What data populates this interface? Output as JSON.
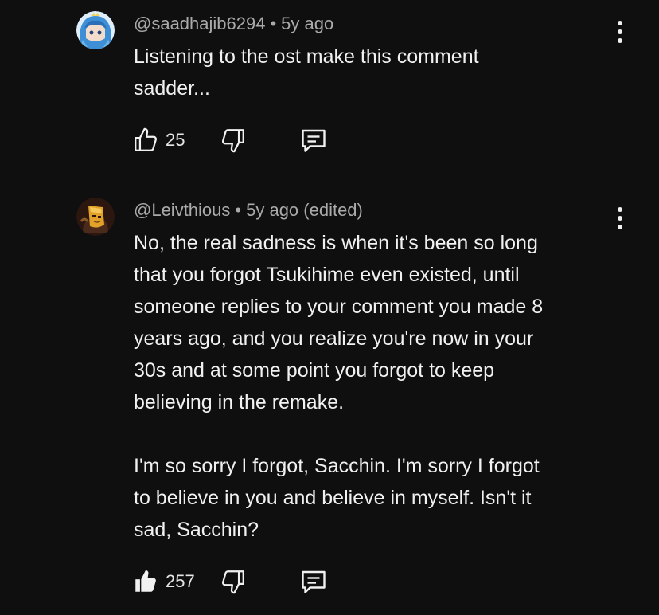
{
  "comments": [
    {
      "author": "@saadhajib6294",
      "separator": "•",
      "time": "5y ago",
      "text": "Listening to the ost make this comment\nsadder...",
      "likes": "25",
      "liked": false,
      "avatar_icon": "blue-hair-anime-avatar",
      "colors": {
        "avatar_bg": "#5aa2d8"
      }
    },
    {
      "author": "@Leivthious",
      "separator": "•",
      "time": "5y ago (edited)",
      "text": "No, the real sadness is when it's been so long\nthat you forgot Tsukihime even existed, until\nsomeone replies to your comment you made 8\nyears ago, and you realize you're now in your\n30s and at some point you forgot to keep\nbelieving in the remake.\n\nI'm so sorry I forgot, Sacchin. I'm sorry I forgot\nto believe in you and believe in myself. Isn't it\nsad, Sacchin?",
      "likes": "257",
      "liked": true,
      "avatar_icon": "golden-mask-avatar",
      "colors": {
        "avatar_bg": "#3a1f14"
      }
    }
  ],
  "colors": {
    "background": "#0f0f0f",
    "text": "#f1f1f1",
    "meta": "#aaaaaa"
  }
}
